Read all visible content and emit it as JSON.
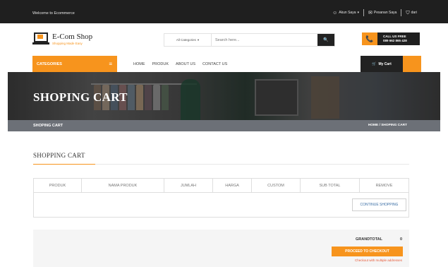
{
  "topbar": {
    "welcome": "Welcome to Ecommerce",
    "account_label": "Akun Saya",
    "account_caret": "▾",
    "orders_label": "Pesanan Saya",
    "cart_label": "dari",
    "account_icon": "user-icon",
    "orders_icon": "envelope-icon",
    "bag_icon": "bag-icon"
  },
  "header": {
    "logo_title": "E-Com Shop",
    "logo_subtitle": "Shopping Made Easy",
    "category_select": "All Categories",
    "category_caret": "▾",
    "search_placeholder": "Search here...",
    "search_icon": "🔍",
    "phone_icon": "📞",
    "call_line1": "CALL US FREE",
    "call_line2": "089 662 865 428"
  },
  "nav": {
    "categories_label": "CATEGORIES",
    "menu_icon": "≡",
    "links": [
      "HOME",
      "PRODUK",
      "ABOUT US",
      "CONTACT US"
    ],
    "cart_icon": "🛒",
    "my_cart_label": "My Cart"
  },
  "banner": {
    "title": "SHOPING CART",
    "breadcrumb_left": "SHOPING CART",
    "breadcrumb_right": "HOME / SHOPING CART"
  },
  "cart": {
    "section_title": "SHOPPING CART",
    "columns": [
      "PRODUK",
      "NAMA PRODUK",
      "JUMLAH",
      "HARGA",
      "CUSTOM",
      "SUB TOTAL",
      "REMOVE"
    ],
    "continue_label": "CONTINUE SHOPPING"
  },
  "totals": {
    "grandtotal_label": "GRANDTOTAL",
    "grandtotal_value": "0",
    "checkout_label": "PROCEED TO CHECKOUT",
    "multiple_label": "Checkout with multiple addresses"
  },
  "colors": {
    "accent": "#f7941d",
    "dark": "#1f1f1f",
    "crumb": "#6c7077"
  }
}
